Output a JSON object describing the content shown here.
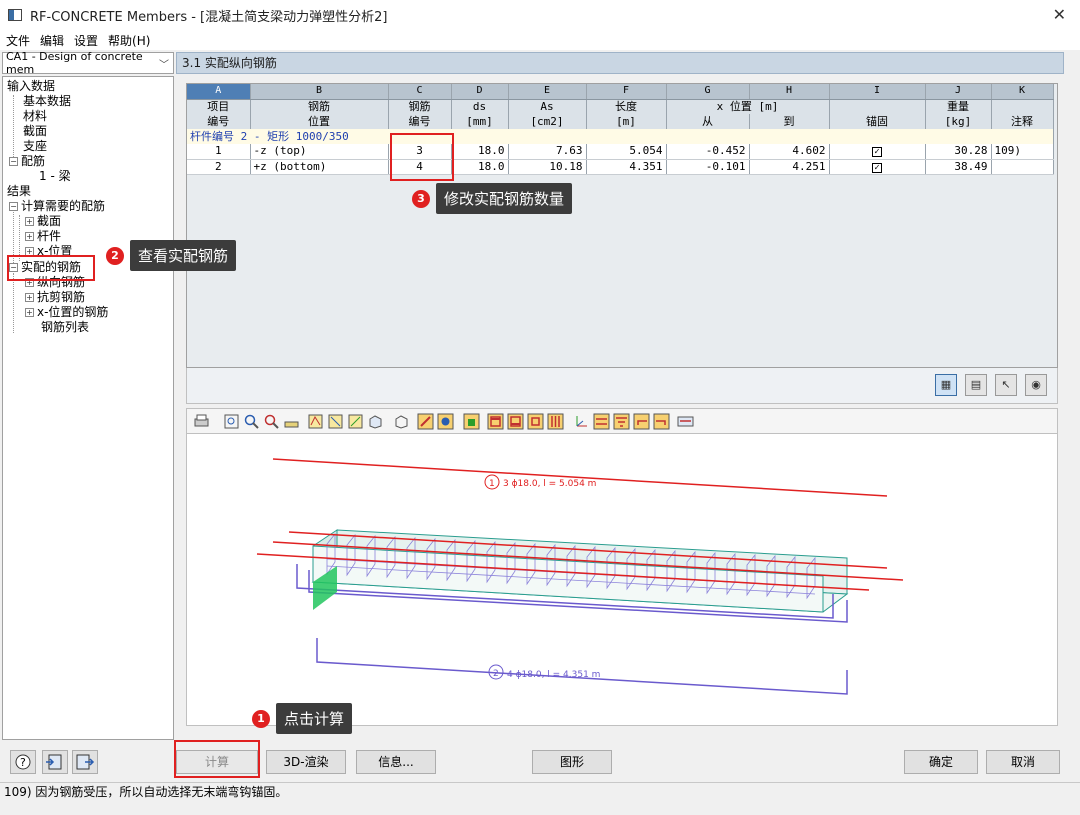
{
  "window": {
    "title": "RF-CONCRETE Members - [混凝土简支梁动力弹塑性分析2]",
    "close": "✕"
  },
  "menu": [
    "文件",
    "编辑",
    "设置",
    "帮助(H)"
  ],
  "case_select": {
    "value": "CA1 - Design of concrete mem"
  },
  "tree": {
    "input": "输入数据",
    "base": "基本数据",
    "material": "材料",
    "section": "截面",
    "support": "支座",
    "reinf": "配筋",
    "beam": "1 - 梁",
    "results": "结果",
    "required": "计算需要的配筋",
    "req_section": "截面",
    "req_member": "杆件",
    "req_x": "x-位置",
    "provided": "实配的钢筋",
    "longitudinal": "纵向钢筋",
    "shear": "抗剪钢筋",
    "x_reinf": "x-位置的钢筋",
    "list": "钢筋列表"
  },
  "section_header": "3.1 实配纵向钢筋",
  "table": {
    "letters": [
      "A",
      "B",
      "C",
      "D",
      "E",
      "F",
      "G",
      "H",
      "I",
      "J",
      "K"
    ],
    "hdr1": [
      "项目",
      "钢筋",
      "钢筋",
      "ds",
      "As",
      "长度",
      "x 位置 [m]",
      "",
      "",
      "重量",
      ""
    ],
    "hdr2": [
      "编号",
      "位置",
      "编号",
      "[mm]",
      "[cm2]",
      "[m]",
      "从",
      "到",
      "锚固",
      "[kg]",
      "注释"
    ],
    "group": "杆件编号 2  -  矩形 1000/350",
    "rows": [
      [
        "1",
        "-z (top)",
        "3",
        "18.0",
        "7.63",
        "5.054",
        "-0.452",
        "4.602",
        "✓",
        "30.28",
        "109)"
      ],
      [
        "2",
        "+z (bottom)",
        "4",
        "18.0",
        "10.18",
        "4.351",
        "-0.101",
        "4.251",
        "✓",
        "38.49",
        ""
      ]
    ]
  },
  "graphic": {
    "label_top": "3 ϕ18.0, l = 5.054 m",
    "label_top_num": "1",
    "label_bottom": "4 ϕ18.0, l = 4.351 m",
    "label_bottom_num": "2"
  },
  "buttons": {
    "calc": "计算",
    "render": "3D-渲染",
    "info": "信息...",
    "graphic": "图形",
    "ok": "确定",
    "cancel": "取消"
  },
  "status": "109) 因为钢筋受压，所以自动选择无末端弯钩锚固。",
  "annotations": [
    {
      "num": "1",
      "text": "点击计算"
    },
    {
      "num": "2",
      "text": "查看实配钢筋"
    },
    {
      "num": "3",
      "text": "修改实配钢筋数量"
    }
  ],
  "colors": {
    "accent": "#e02020",
    "header": "#c9d6e3",
    "rebar": "#e02020",
    "stirrup": "#6a5acd"
  }
}
